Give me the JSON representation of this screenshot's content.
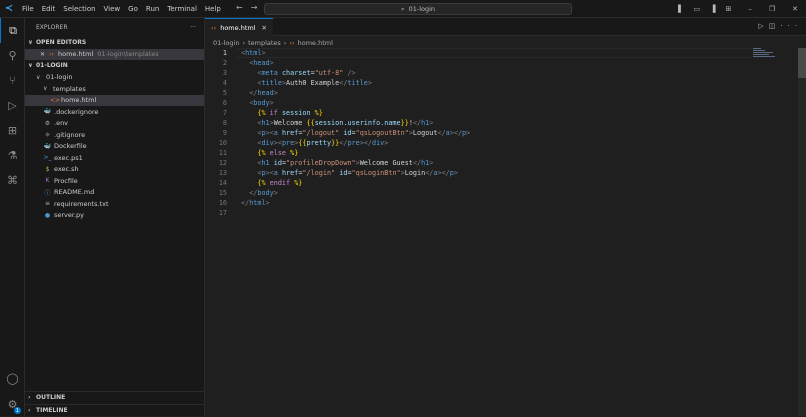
{
  "menu": [
    "File",
    "Edit",
    "Selection",
    "View",
    "Go",
    "Run",
    "Terminal",
    "Help"
  ],
  "search": "01-login",
  "colors": {
    "accent": "#0078d4",
    "html_icon": "#e37933"
  },
  "sidebar": {
    "title": "EXPLORER",
    "more": "···",
    "open_editors": "OPEN EDITORS",
    "open_file": "home.html",
    "open_file_path": "01-login\\templates",
    "root": "01-LOGIN",
    "tree": [
      {
        "label": "01-login",
        "depth": 0,
        "chev": "∨",
        "icon": ""
      },
      {
        "label": "templates",
        "depth": 1,
        "chev": "∨",
        "icon": ""
      },
      {
        "label": "home.html",
        "depth": 2,
        "chev": "",
        "icon": "<>",
        "color": "#e37933",
        "selected": true
      },
      {
        "label": ".dockerignore",
        "depth": 1,
        "chev": "",
        "icon": "🐳",
        "color": "#567"
      },
      {
        "label": ".env",
        "depth": 1,
        "chev": "",
        "icon": "⚙",
        "color": "#aaa"
      },
      {
        "label": ".gitignore",
        "depth": 1,
        "chev": "",
        "icon": "◆",
        "color": "#556"
      },
      {
        "label": "Dockerfile",
        "depth": 1,
        "chev": "",
        "icon": "🐳",
        "color": "#4a9ad8"
      },
      {
        "label": "exec.ps1",
        "depth": 1,
        "chev": "",
        "icon": ">_",
        "color": "#4a9ad8"
      },
      {
        "label": "exec.sh",
        "depth": 1,
        "chev": "",
        "icon": "$",
        "color": "#8dc149"
      },
      {
        "label": "Procfile",
        "depth": 1,
        "chev": "",
        "icon": "K",
        "color": "#a074c4"
      },
      {
        "label": "README.md",
        "depth": 1,
        "chev": "",
        "icon": "ⓘ",
        "color": "#4a9ad8"
      },
      {
        "label": "requirements.txt",
        "depth": 1,
        "chev": "",
        "icon": "≡",
        "color": "#aaa"
      },
      {
        "label": "server.py",
        "depth": 1,
        "chev": "",
        "icon": "●",
        "color": "#4a9ad8"
      }
    ],
    "outline": "OUTLINE",
    "timeline": "TIMELINE"
  },
  "activity": {
    "settings_badge": "1"
  },
  "editor": {
    "tab": "home.html",
    "breadcrumb": [
      "01-login",
      "templates",
      "home.html"
    ],
    "lines": [
      [
        [
          "t",
          "<"
        ],
        [
          "tn",
          "html"
        ],
        [
          "t",
          ">"
        ]
      ],
      [
        [
          "tx",
          "  "
        ],
        [
          "t",
          "<"
        ],
        [
          "tn",
          "head"
        ],
        [
          "t",
          ">"
        ]
      ],
      [
        [
          "tx",
          "    "
        ],
        [
          "t",
          "<"
        ],
        [
          "tn",
          "meta"
        ],
        [
          "tx",
          " "
        ],
        [
          "at",
          "charset"
        ],
        [
          "tx",
          "="
        ],
        [
          "st",
          "\"utf-8\""
        ],
        [
          "tx",
          " "
        ],
        [
          "t",
          "/>"
        ]
      ],
      [
        [
          "tx",
          "    "
        ],
        [
          "t",
          "<"
        ],
        [
          "tn",
          "title"
        ],
        [
          "t",
          ">"
        ],
        [
          "tx",
          "Auth0 Example"
        ],
        [
          "t",
          "</"
        ],
        [
          "tn",
          "title"
        ],
        [
          "t",
          ">"
        ]
      ],
      [
        [
          "tx",
          "  "
        ],
        [
          "t",
          "</"
        ],
        [
          "tn",
          "head"
        ],
        [
          "t",
          ">"
        ]
      ],
      [
        [
          "tx",
          "  "
        ],
        [
          "t",
          "<"
        ],
        [
          "tn",
          "body"
        ],
        [
          "t",
          ">"
        ]
      ],
      [
        [
          "tx",
          "    "
        ],
        [
          "jj",
          "{%"
        ],
        [
          "kw",
          " if "
        ],
        [
          "va",
          "session"
        ],
        [
          "jj",
          " %}"
        ]
      ],
      [
        [
          "tx",
          "    "
        ],
        [
          "t",
          "<"
        ],
        [
          "tn",
          "h1"
        ],
        [
          "t",
          ">"
        ],
        [
          "tx",
          "Welcome "
        ],
        [
          "jj",
          "{{"
        ],
        [
          "va",
          "session.userinfo.name"
        ],
        [
          "jj",
          "}}"
        ],
        [
          "tx",
          "!"
        ],
        [
          "t",
          "</"
        ],
        [
          "tn",
          "h1"
        ],
        [
          "t",
          ">"
        ]
      ],
      [
        [
          "tx",
          "    "
        ],
        [
          "t",
          "<"
        ],
        [
          "tn",
          "p"
        ],
        [
          "t",
          "><"
        ],
        [
          "tn",
          "a"
        ],
        [
          "tx",
          " "
        ],
        [
          "at",
          "href"
        ],
        [
          "tx",
          "="
        ],
        [
          "st",
          "\"/logout\""
        ],
        [
          "tx",
          " "
        ],
        [
          "at",
          "id"
        ],
        [
          "tx",
          "="
        ],
        [
          "st",
          "\"qsLogoutBtn\""
        ],
        [
          "t",
          ">"
        ],
        [
          "tx",
          "Logout"
        ],
        [
          "t",
          "</"
        ],
        [
          "tn",
          "a"
        ],
        [
          "t",
          "></"
        ],
        [
          "tn",
          "p"
        ],
        [
          "t",
          ">"
        ]
      ],
      [
        [
          "tx",
          "    "
        ],
        [
          "t",
          "<"
        ],
        [
          "tn",
          "div"
        ],
        [
          "t",
          "><"
        ],
        [
          "tn",
          "pre"
        ],
        [
          "t",
          ">"
        ],
        [
          "jj",
          "{{"
        ],
        [
          "va",
          "pretty"
        ],
        [
          "jj",
          "}}"
        ],
        [
          "t",
          "</"
        ],
        [
          "tn",
          "pre"
        ],
        [
          "t",
          "></"
        ],
        [
          "tn",
          "div"
        ],
        [
          "t",
          ">"
        ]
      ],
      [
        [
          "tx",
          "    "
        ],
        [
          "jj",
          "{%"
        ],
        [
          "kw",
          " else "
        ],
        [
          "jj",
          "%}"
        ]
      ],
      [
        [
          "tx",
          "    "
        ],
        [
          "t",
          "<"
        ],
        [
          "tn",
          "h1"
        ],
        [
          "tx",
          " "
        ],
        [
          "at",
          "id"
        ],
        [
          "tx",
          "="
        ],
        [
          "st",
          "\"profileDropDown\""
        ],
        [
          "t",
          ">"
        ],
        [
          "tx",
          "Welcome Guest"
        ],
        [
          "t",
          "</"
        ],
        [
          "tn",
          "h1"
        ],
        [
          "t",
          ">"
        ]
      ],
      [
        [
          "tx",
          "    "
        ],
        [
          "t",
          "<"
        ],
        [
          "tn",
          "p"
        ],
        [
          "t",
          "><"
        ],
        [
          "tn",
          "a"
        ],
        [
          "tx",
          " "
        ],
        [
          "at",
          "href"
        ],
        [
          "tx",
          "="
        ],
        [
          "st",
          "\"/login\""
        ],
        [
          "tx",
          " "
        ],
        [
          "at",
          "id"
        ],
        [
          "tx",
          "="
        ],
        [
          "st",
          "\"qsLoginBtn\""
        ],
        [
          "t",
          ">"
        ],
        [
          "tx",
          "Login"
        ],
        [
          "t",
          "</"
        ],
        [
          "tn",
          "a"
        ],
        [
          "t",
          "></"
        ],
        [
          "tn",
          "p"
        ],
        [
          "t",
          ">"
        ]
      ],
      [
        [
          "tx",
          "    "
        ],
        [
          "jj",
          "{%"
        ],
        [
          "kw",
          " endif "
        ],
        [
          "jj",
          "%}"
        ]
      ],
      [
        [
          "tx",
          "  "
        ],
        [
          "t",
          "</"
        ],
        [
          "tn",
          "body"
        ],
        [
          "t",
          ">"
        ]
      ],
      [
        [
          "t",
          "</"
        ],
        [
          "tn",
          "html"
        ],
        [
          "t",
          ">"
        ]
      ],
      []
    ]
  }
}
